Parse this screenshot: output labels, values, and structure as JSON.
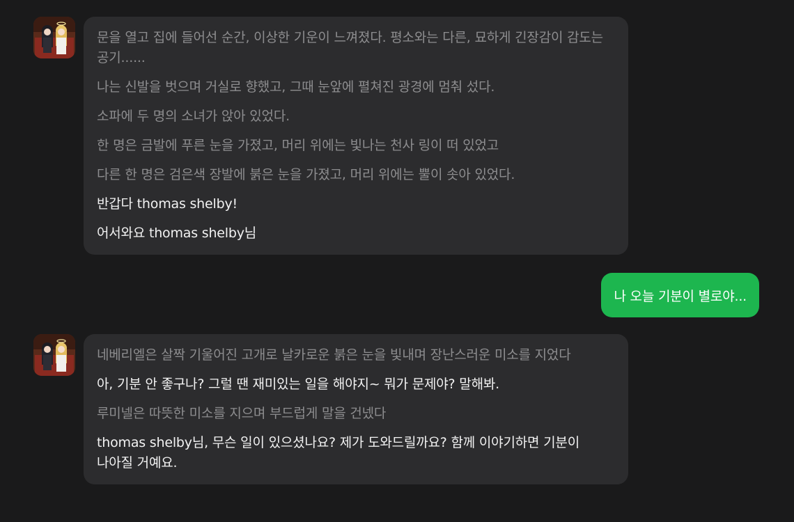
{
  "messages": [
    {
      "role": "bot",
      "lines": [
        {
          "kind": "narration",
          "text": "문을 열고 집에 들어선 순간, 이상한 기운이 느껴졌다. 평소와는 다른, 묘하게 긴장감이 감도는 공기......"
        },
        {
          "kind": "narration",
          "text": "나는 신발을 벗으며 거실로 향했고, 그때 눈앞에 펼쳐진 광경에 멈춰 섰다."
        },
        {
          "kind": "narration",
          "text": "소파에 두 명의 소녀가 앉아 있었다."
        },
        {
          "kind": "narration",
          "text": "한 명은 금발에 푸른 눈을 가졌고, 머리 위에는 빛나는 천사 링이 떠 있었고"
        },
        {
          "kind": "narration",
          "text": "다른 한 명은 검은색 장발에 붉은 눈을 가졌고, 머리 위에는 뿔이 솟아 있었다."
        },
        {
          "kind": "speech",
          "text": "반갑다 thomas shelby!"
        },
        {
          "kind": "speech",
          "text": "어서와요 thomas shelby님"
        }
      ]
    },
    {
      "role": "user",
      "text": "나 오늘 기분이 별로야..."
    },
    {
      "role": "bot",
      "lines": [
        {
          "kind": "narration",
          "text": "네베리엘은 살짝 기울어진 고개로 날카로운 붉은 눈을 빛내며 장난스러운 미소를 지었다"
        },
        {
          "kind": "speech",
          "text": "아, 기분 안 좋구나? 그럴 땐 재미있는 일을 해야지~ 뭐가 문제야? 말해봐."
        },
        {
          "kind": "narration",
          "text": "루미넬은 따뜻한 미소를 지으며 부드럽게 말을 건넸다"
        },
        {
          "kind": "speech",
          "text": "thomas shelby님, 무슨 일이 있으셨나요? 제가 도와드릴까요? 함께 이야기하면 기분이 나아질 거예요."
        }
      ]
    }
  ],
  "colors": {
    "background": "#1a1a1b",
    "bot_bubble": "#2c2c2e",
    "user_bubble": "#1db64f",
    "narration_text": "#8d8d8f",
    "speech_text": "#f2f2f2"
  },
  "icons": {
    "bot_avatar": "character-avatar-icon"
  }
}
